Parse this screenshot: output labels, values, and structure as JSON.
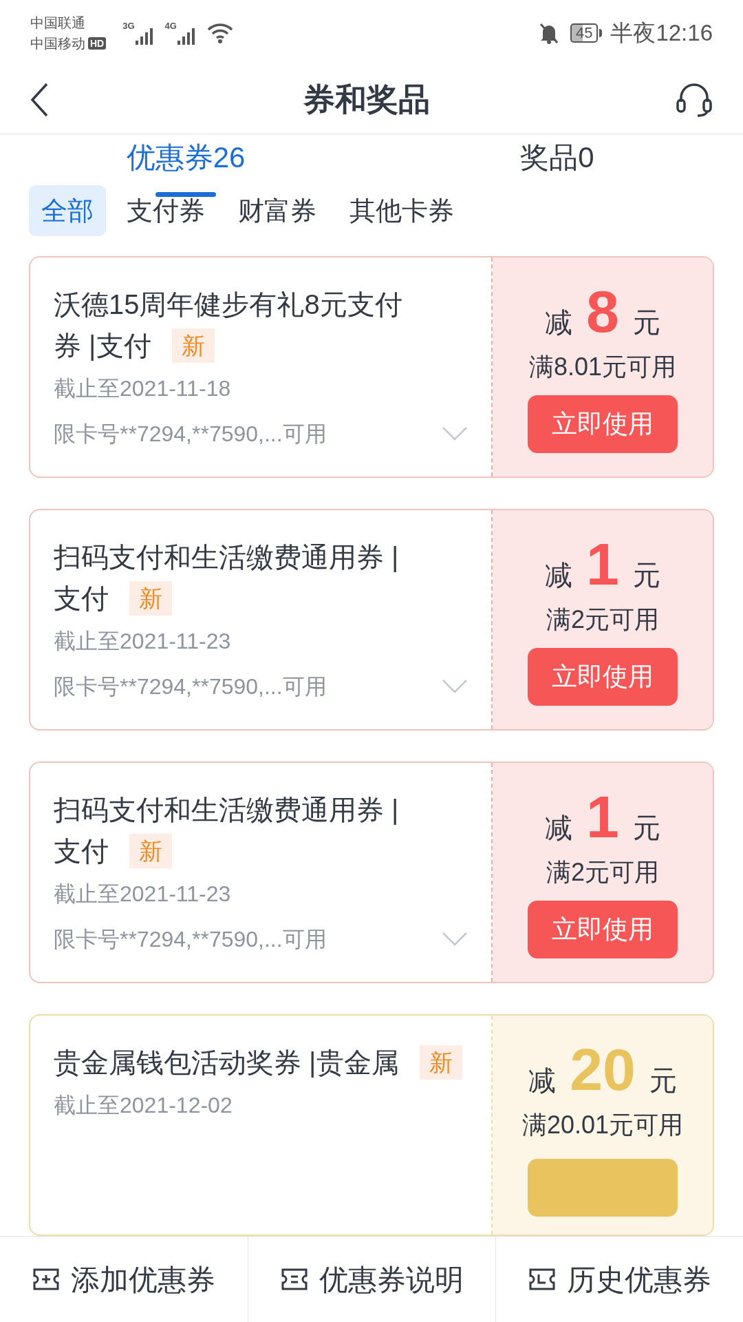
{
  "status_bar": {
    "carriers": [
      "中国联通",
      "中国移动"
    ],
    "hd_badge": "HD",
    "signal_1": "3G",
    "signal_2": "4G",
    "battery": "45",
    "time": "半夜12:16"
  },
  "header": {
    "title": "券和奖品"
  },
  "tabs": [
    {
      "label": "优惠券26",
      "selected": true
    },
    {
      "label": "奖品0",
      "selected": false
    }
  ],
  "filters": [
    {
      "label": "全部",
      "selected": true
    },
    {
      "label": "支付券",
      "selected": false
    },
    {
      "label": "财富券",
      "selected": false
    },
    {
      "label": "其他卡券",
      "selected": false
    }
  ],
  "coupons": [
    {
      "kind": "payment",
      "title_lines": [
        "沃德15周年健步有礼8元支付",
        "券 |支付"
      ],
      "badge": "新",
      "deadline": "截止至2021-11-18",
      "cards": "限卡号**7294,**7590,...可用",
      "prefix": "减",
      "amount": "8",
      "unit": "元",
      "condition": "满8.01元可用",
      "button": "立即使用"
    },
    {
      "kind": "payment",
      "title_lines": [
        "扫码支付和生活缴费通用券 |",
        "支付"
      ],
      "badge": "新",
      "deadline": "截止至2021-11-23",
      "cards": "限卡号**7294,**7590,...可用",
      "prefix": "减",
      "amount": "1",
      "unit": "元",
      "condition": "满2元可用",
      "button": "立即使用"
    },
    {
      "kind": "payment",
      "title_lines": [
        "扫码支付和生活缴费通用券 |",
        "支付"
      ],
      "badge": "新",
      "deadline": "截止至2021-11-23",
      "cards": "限卡号**7294,**7590,...可用",
      "prefix": "减",
      "amount": "1",
      "unit": "元",
      "condition": "满2元可用",
      "button": "立即使用"
    },
    {
      "kind": "metal",
      "title_lines": [
        "贵金属钱包活动奖券 |贵金属"
      ],
      "badge": "新",
      "deadline": "截止至2021-12-02",
      "prefix": "减",
      "amount": "20",
      "unit": "元",
      "condition": "满20.01元可用"
    }
  ],
  "bottom_bar": [
    {
      "label": "添加优惠券"
    },
    {
      "label": "优惠券说明"
    },
    {
      "label": "历史优惠券"
    }
  ]
}
